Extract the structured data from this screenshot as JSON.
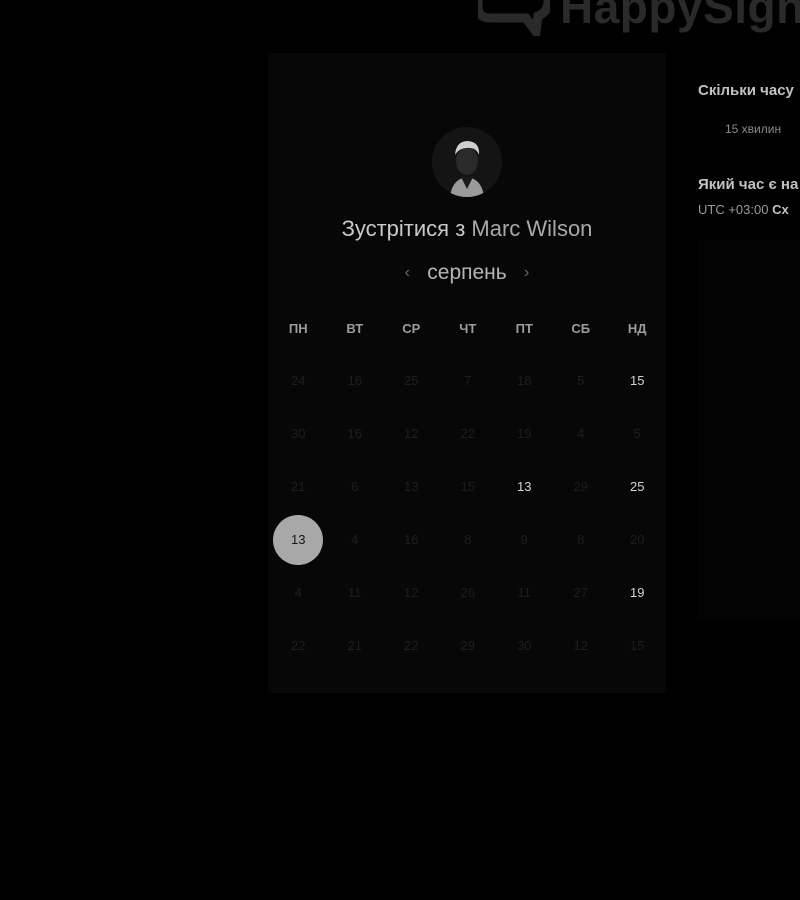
{
  "brand": {
    "name": "HappySigna"
  },
  "booking": {
    "title_prefix": "Зустрітися з",
    "host_name": "Marc Wilson"
  },
  "calendar": {
    "month": "серпень",
    "prev_icon": "chevron-left-icon",
    "next_icon": "chevron-right-icon",
    "weekdays": [
      "ПН",
      "ВТ",
      "СР",
      "ЧТ",
      "ПТ",
      "СБ",
      "НД"
    ],
    "weeks": [
      [
        "24",
        "16",
        "25",
        "7",
        "18",
        "5",
        "15"
      ],
      [
        "30",
        "16",
        "12",
        "22",
        "19",
        "4",
        "5"
      ],
      [
        "21",
        "6",
        "13",
        "15",
        "13",
        "29",
        "25"
      ],
      [
        "13",
        "4",
        "16",
        "8",
        "9",
        "8",
        "20"
      ],
      [
        "4",
        "11",
        "12",
        "26",
        "11",
        "27",
        "19"
      ],
      [
        "22",
        "21",
        "22",
        "29",
        "30",
        "12",
        "15"
      ]
    ],
    "available": [
      [
        0,
        6
      ],
      [
        2,
        4
      ],
      [
        2,
        6
      ],
      [
        4,
        6
      ]
    ],
    "selected": [
      3,
      0
    ]
  },
  "sidebar": {
    "duration_heading": "Скільки часу",
    "duration_value": "15 хвилин",
    "timezone_heading": "Який час є на",
    "timezone_offset": "UTC +03:00",
    "timezone_name": "Сх"
  },
  "colors": {
    "background": "#000000",
    "card": "#070707",
    "selected_day": "#a8a8a8"
  }
}
